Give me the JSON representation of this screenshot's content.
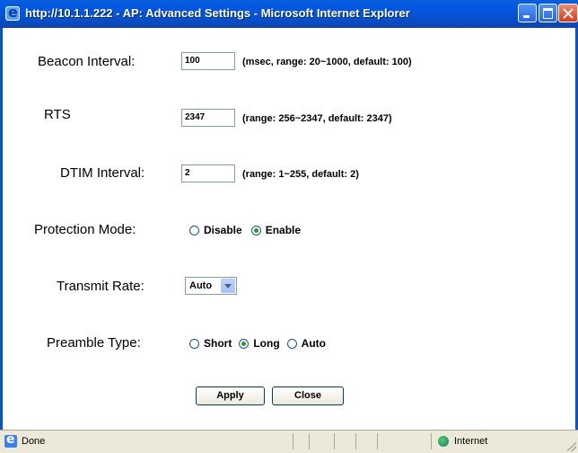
{
  "window": {
    "title": "http://10.1.1.222 - AP: Advanced Settings - Microsoft Internet Explorer"
  },
  "form": {
    "beacon": {
      "label": "Beacon Interval:",
      "value": "100",
      "hint": "(msec, range: 20~1000, default: 100)"
    },
    "rts": {
      "label": "RTS",
      "value": "2347",
      "hint": "(range: 256~2347, default: 2347)"
    },
    "dtim": {
      "label": "DTIM Interval:",
      "value": "2",
      "hint": "(range: 1~255, default: 2)"
    },
    "protection": {
      "label": "Protection Mode:",
      "options": [
        "Disable",
        "Enable"
      ],
      "selected": "Enable"
    },
    "transmit": {
      "label": "Transmit Rate:",
      "value": "Auto"
    },
    "preamble": {
      "label": "Preamble Type:",
      "options": [
        "Short",
        "Long",
        "Auto"
      ],
      "selected": "Long"
    },
    "apply_label": "Apply",
    "close_label": "Close"
  },
  "status": {
    "text": "Done",
    "zone": "Internet"
  },
  "icons": [
    "ie-icon",
    "minimize-icon",
    "maximize-icon",
    "close-icon",
    "radio-icon",
    "dropdown-arrow-icon",
    "page-icon",
    "globe-icon",
    "resize-grip-icon"
  ],
  "colors": {
    "titlebar": "#0653d3",
    "checked_radio": "#21a121",
    "statusbar": "#ece9d8"
  }
}
